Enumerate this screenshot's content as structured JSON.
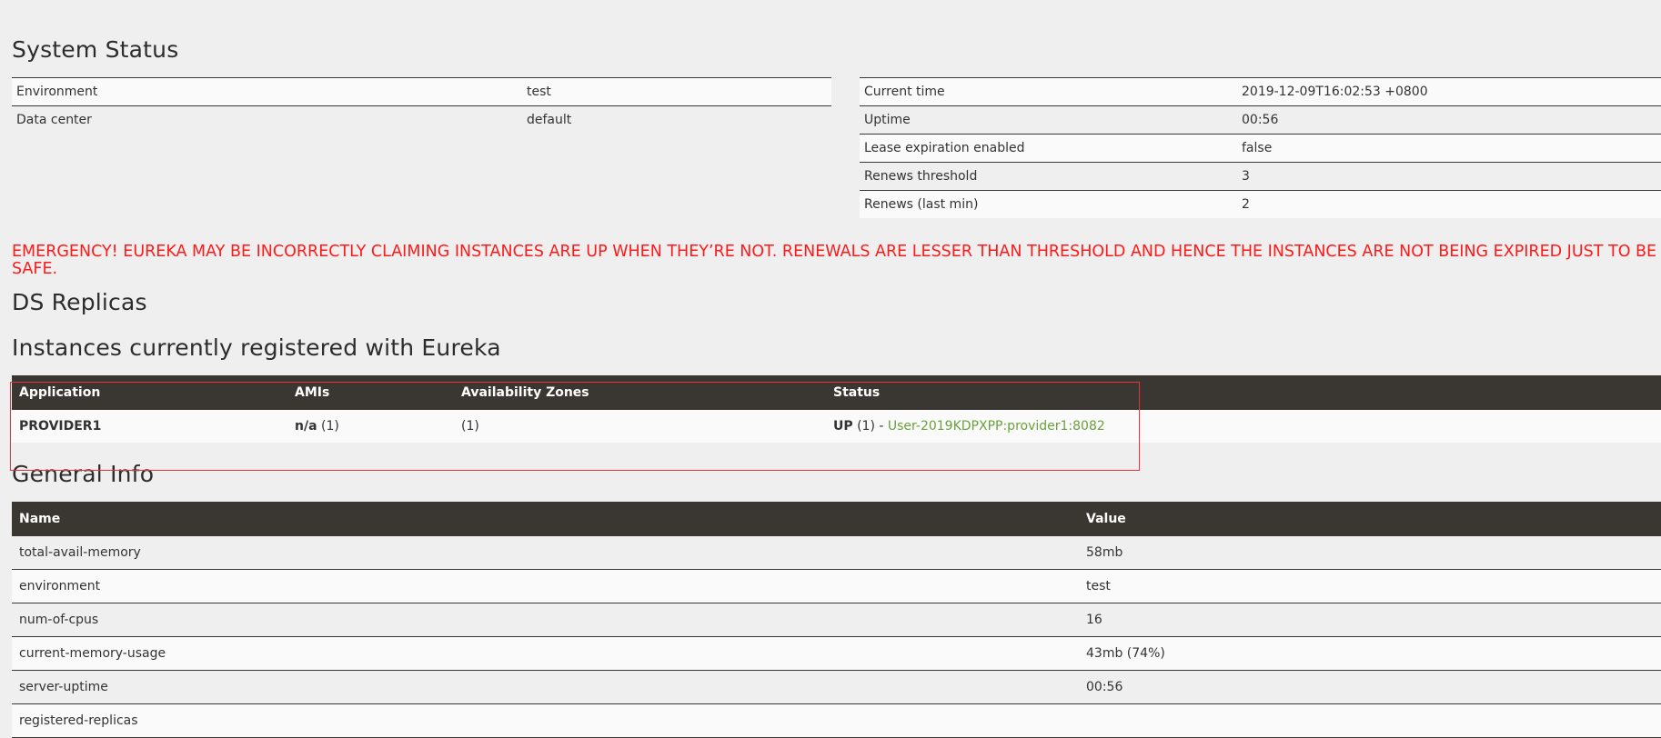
{
  "system_status": {
    "title": "System Status",
    "left": [
      {
        "label": "Environment",
        "value": "test"
      },
      {
        "label": "Data center",
        "value": "default"
      }
    ],
    "right": [
      {
        "label": "Current time",
        "value": "2019-12-09T16:02:53 +0800"
      },
      {
        "label": "Uptime",
        "value": "00:56"
      },
      {
        "label": "Lease expiration enabled",
        "value": "false"
      },
      {
        "label": "Renews threshold",
        "value": "3"
      },
      {
        "label": "Renews (last min)",
        "value": "2"
      }
    ]
  },
  "emergency": "EMERGENCY! EUREKA MAY BE INCORRECTLY CLAIMING INSTANCES ARE UP WHEN THEY’RE NOT. RENEWALS ARE LESSER THAN THRESHOLD AND HENCE THE INSTANCES ARE NOT BEING EXPIRED JUST TO BE SAFE.",
  "ds_replicas": {
    "title": "DS Replicas"
  },
  "instances": {
    "title": "Instances currently registered with Eureka",
    "headers": [
      "Application",
      "AMIs",
      "Availability Zones",
      "Status"
    ],
    "rows": [
      {
        "application": "PROVIDER1",
        "amis_bold": "n/a",
        "amis_count": "(1)",
        "zones": "(1)",
        "status_bold": "UP",
        "status_count": "(1) -",
        "status_link": "User-2019KDPXPP:provider1:8082"
      }
    ]
  },
  "general_info": {
    "title": "General Info",
    "headers": [
      "Name",
      "Value"
    ],
    "rows": [
      {
        "name": "total-avail-memory",
        "value": "58mb"
      },
      {
        "name": "environment",
        "value": "test"
      },
      {
        "name": "num-of-cpus",
        "value": "16"
      },
      {
        "name": "current-memory-usage",
        "value": "43mb (74%)"
      },
      {
        "name": "server-uptime",
        "value": "00:56"
      },
      {
        "name": "registered-replicas",
        "value": ""
      }
    ]
  },
  "colors": {
    "background": "#efefef",
    "header_dark": "#3a3632",
    "emergency_red": "#ff1a1a",
    "link_green": "#6aa13a",
    "highlight_box": "#e8323c"
  }
}
